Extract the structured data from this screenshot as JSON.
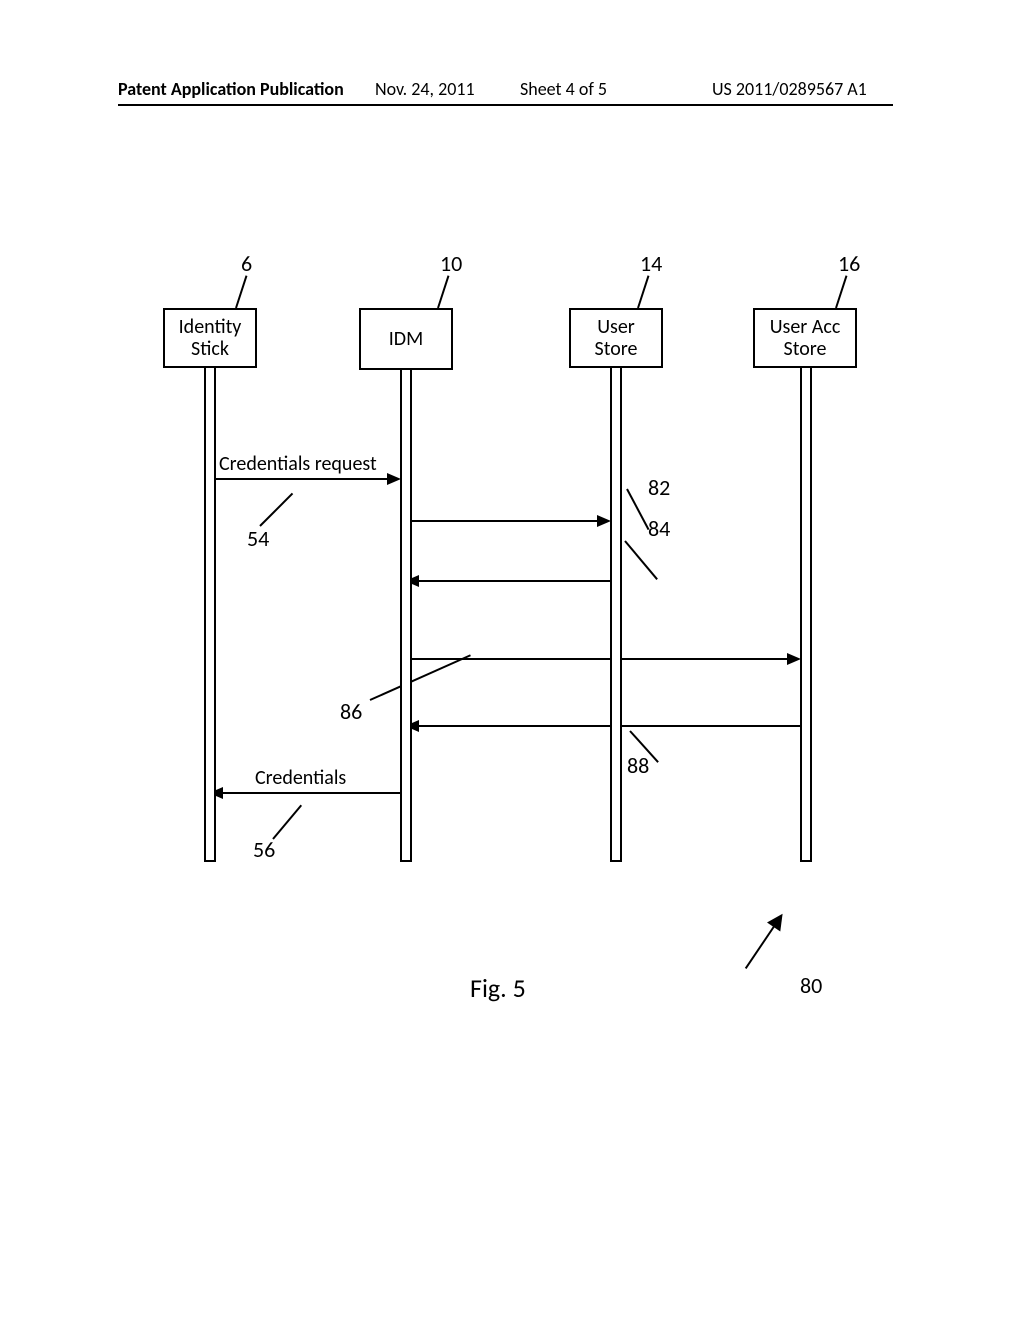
{
  "header": {
    "left": "Patent Application Publication",
    "mid_date": "Nov. 24, 2011",
    "mid_sheet": "Sheet 4 of 5",
    "right": "US 2011/0289567 A1"
  },
  "participants": {
    "p1": {
      "label_line1": "Identity",
      "label_line2": "Stick",
      "ref": "6"
    },
    "p2": {
      "label": "IDM",
      "ref": "10"
    },
    "p3": {
      "label_line1": "User",
      "label_line2": "Store",
      "ref": "14"
    },
    "p4": {
      "label_line1": "User Acc",
      "label_line2": "Store",
      "ref": "16"
    }
  },
  "messages": {
    "m1": {
      "label": "Credentials request",
      "ref": "54"
    },
    "m2": {
      "ref": "82"
    },
    "m3": {
      "ref": "84"
    },
    "m4": {
      "ref": "86"
    },
    "m5": {
      "ref": "88"
    },
    "m6": {
      "label": "Credentials",
      "ref": "56"
    }
  },
  "figure": {
    "label": "Fig. 5",
    "pointer_ref": "80"
  }
}
